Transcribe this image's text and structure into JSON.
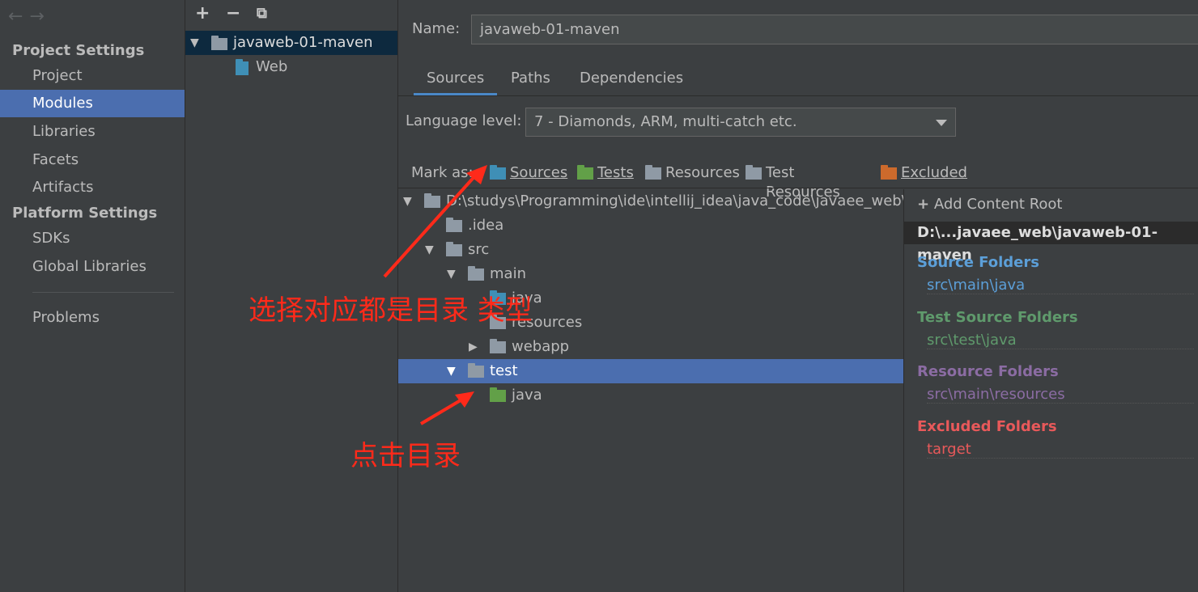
{
  "nav": {
    "project_settings": "Project Settings",
    "platform_settings": "Platform Settings",
    "items": [
      {
        "label": "Project"
      },
      {
        "label": "Modules"
      },
      {
        "label": "Libraries"
      },
      {
        "label": "Facets"
      },
      {
        "label": "Artifacts"
      }
    ],
    "platform_items": [
      {
        "label": "SDKs"
      },
      {
        "label": "Global Libraries"
      }
    ],
    "problems": "Problems"
  },
  "modules": {
    "root": "javaweb-01-maven",
    "child": "Web"
  },
  "right": {
    "name_label": "Name:",
    "name_value": "javaweb-01-maven",
    "tabs": [
      "Sources",
      "Paths",
      "Dependencies"
    ],
    "language_label": "Language level:",
    "language_value": "7 - Diamonds, ARM, multi-catch etc.",
    "mark_as_label": "Mark as:",
    "mark_as": [
      "Sources",
      "Tests",
      "Resources",
      "Test Resources",
      "Excluded"
    ]
  },
  "tree": {
    "root": "D:\\studys\\Programming\\ide\\intellij_idea\\java_code\\javaee_web\\ja",
    "idea": ".idea",
    "src": "src",
    "main": "main",
    "main_java": "java",
    "resources": "resources",
    "webapp": "webapp",
    "test": "test",
    "test_java": "java"
  },
  "content_root": {
    "add_label": "Add Content Root",
    "path": "D:\\...javaee_web\\javaweb-01-maven",
    "source_title": "Source Folders",
    "source_path": "src\\main\\java",
    "test_title": "Test Source Folders",
    "test_path": "src\\test\\java",
    "resource_title": "Resource Folders",
    "resource_path": "src\\main\\resources",
    "excluded_title": "Excluded Folders",
    "excluded_path": "target"
  },
  "annotations": {
    "select_type": "选择对应都是目录 类型",
    "click_dir": "点击目录"
  },
  "colors": {
    "selection": "#4b6eaf",
    "source": "#5c9fd8",
    "test": "#5f9a6c",
    "resource": "#8b6ca3",
    "excluded": "#e8595a",
    "annotation": "#ff2a1a"
  }
}
